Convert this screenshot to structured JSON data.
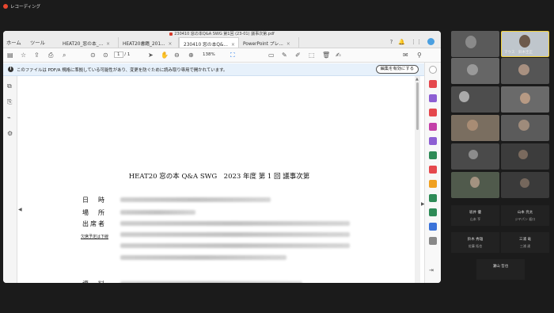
{
  "recording": {
    "label": "レコーディング"
  },
  "window": {
    "title": "230410 窓の本Q&A SWG 第1回 (23-01) 議事次第.pdf",
    "nav_tabs": [
      "ホーム",
      "ツール"
    ],
    "doc_tabs": [
      {
        "label": "HEAT20_窓の本_..."
      },
      {
        "label": "HEAT20書籍_201..."
      },
      {
        "label": "230410 窓の本Q&..."
      },
      {
        "label": "PowerPoint プレ..."
      }
    ],
    "close_glyph": "×"
  },
  "toolbar": {
    "page_current": "1",
    "page_total": "/ 1",
    "zoom": "138%"
  },
  "notice": {
    "text": "このファイルは PDF/A 規格に準拠している可能性があり、変更を防ぐために読み取り専用で開かれています。",
    "button": "編集を有効にする"
  },
  "document": {
    "title": "HEAT20 窓の本 Q&A SWG　2023 年度 第 1 回 議事次第",
    "labels": {
      "date": "日　時",
      "place": "場　所",
      "attendees": "出席者",
      "absent_note": "欠席予定は下線",
      "materials": "資　料"
    }
  },
  "participants": {
    "active_name": "マウス　鈴木圭正",
    "names": [
      {
        "name": "坂井 優",
        "sub": "山本 亨"
      },
      {
        "name": "山本 亮太",
        "sub": "ジヤパン 坂口"
      },
      {
        "name": "鈴木 秀雄",
        "sub": "佐藤 拓也"
      },
      {
        "name": "三浦 竜",
        "sub": "三浦 達"
      },
      {
        "name": "瀬山 哲也",
        "sub": ""
      }
    ]
  },
  "colors": {
    "accent": "#1a73e8",
    "record": "#e8462f",
    "active_border": "#f2d13a"
  }
}
